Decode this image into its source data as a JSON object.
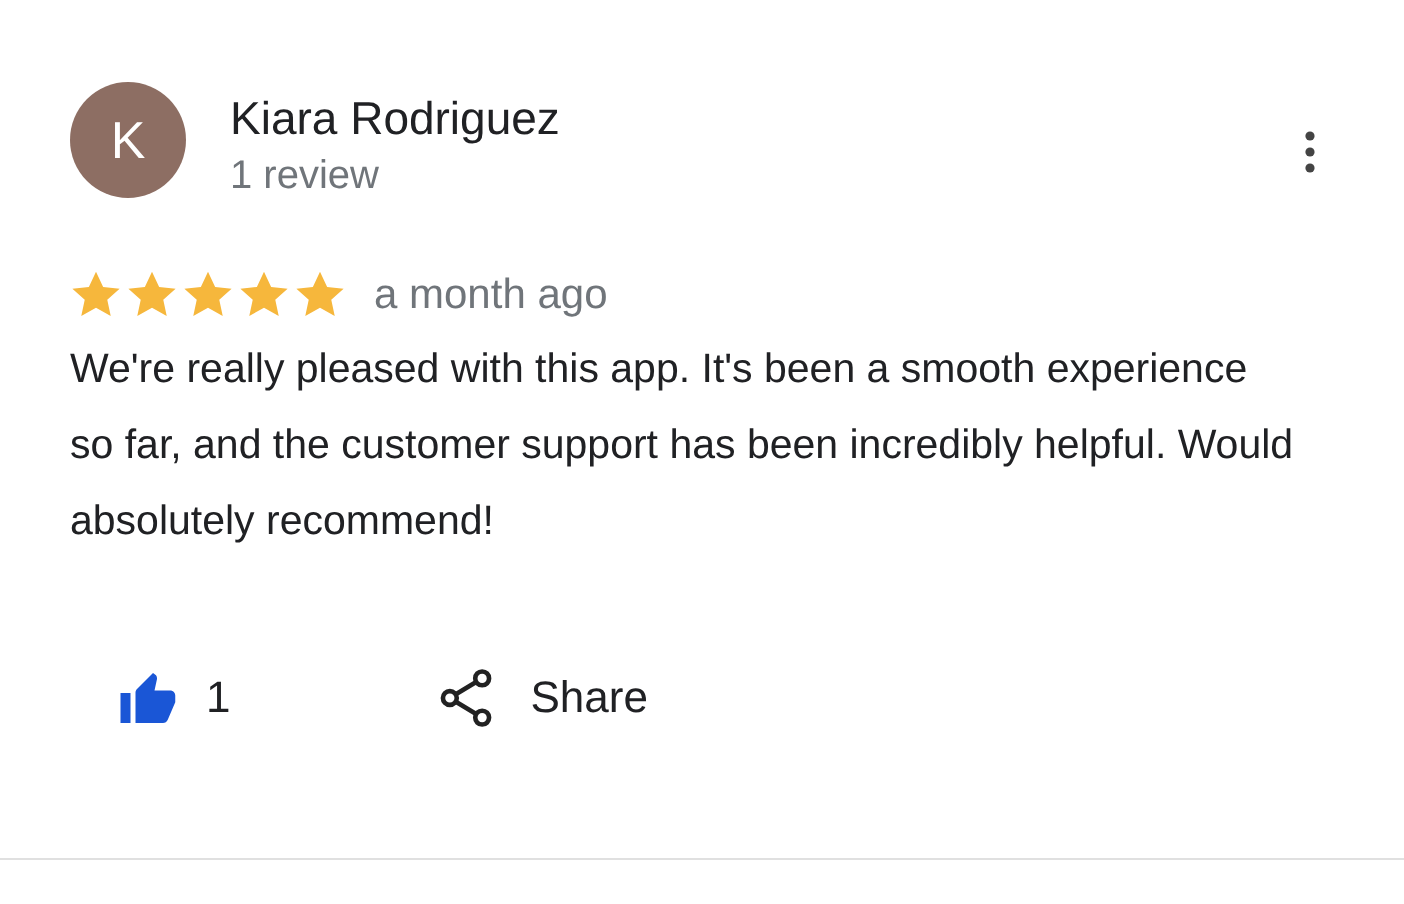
{
  "reviewer": {
    "initial": "K",
    "name": "Kiara Rodriguez",
    "review_count": "1 review"
  },
  "rating": {
    "stars": 5
  },
  "time": "a month ago",
  "text": "We're really pleased with this app. It's been a smooth experience so far, and the customer support has been incredibly helpful. Would absolutely recommend!",
  "like": {
    "liked": true,
    "count": "1"
  },
  "share": {
    "label": "Share"
  }
}
